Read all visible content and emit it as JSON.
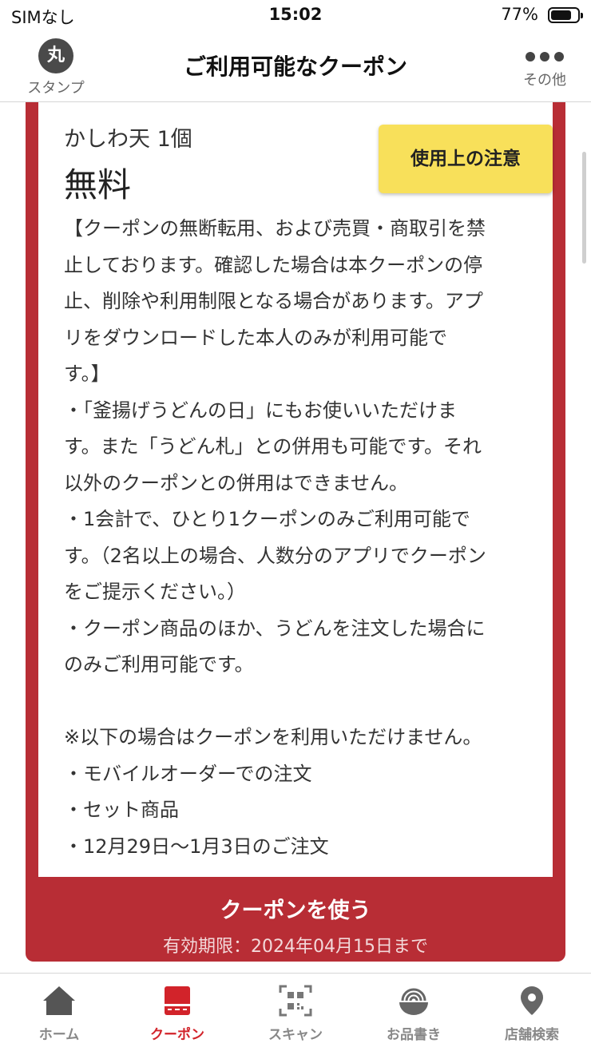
{
  "status_bar": {
    "carrier": "SIMなし",
    "time": "15:02",
    "battery_percent": "77%",
    "battery_level": 0.77
  },
  "header": {
    "left_label": "スタンプ",
    "left_icon_glyph": "丸",
    "title": "ご利用可能なクーポン",
    "right_label": "その他"
  },
  "coupon": {
    "name": "かしわ天 1個",
    "value": "無料",
    "notice_button": "使用上の注意",
    "terms": [
      "【クーポンの無断転用、および売買・商取引を禁",
      "止しております。確認した場合は本クーポンの停",
      "止、削除や利用制限となる場合があります。アプ",
      "リをダウンロードした本人のみが利用可能で",
      "す。】",
      "・「釜揚げうどんの日」にもお使いいただけま",
      "す。また「うどん札」との併用も可能です。それ",
      "以外のクーポンとの併用はできません。",
      "・1会計で、ひとり1クーポンのみご利用可能で",
      "す。（2名以上の場合、人数分のアプリでクーポン",
      "をご提示ください。）",
      "・クーポン商品のほか、うどんを注文した場合に",
      "のみご利用可能です。",
      "",
      "※以下の場合はクーポンを利用いただけません。",
      "・モバイルオーダーでの注文",
      "・セット商品",
      "・12月29日〜1月3日のご注文"
    ],
    "use_button": "クーポンを使う",
    "expiry": "有効期限：2024年04月15日まで"
  },
  "tabs": [
    {
      "label": "ホーム",
      "icon": "home-icon",
      "active": false
    },
    {
      "label": "クーポン",
      "icon": "coupon-icon",
      "active": true
    },
    {
      "label": "スキャン",
      "icon": "qr-scan-icon",
      "active": false
    },
    {
      "label": "お品書き",
      "icon": "menu-bowl-icon",
      "active": false
    },
    {
      "label": "店舗検索",
      "icon": "location-pin-icon",
      "active": false
    }
  ],
  "colors": {
    "accent_red": "#b82d35",
    "tab_active": "#d2232a",
    "notice_yellow": "#f8e05a"
  }
}
